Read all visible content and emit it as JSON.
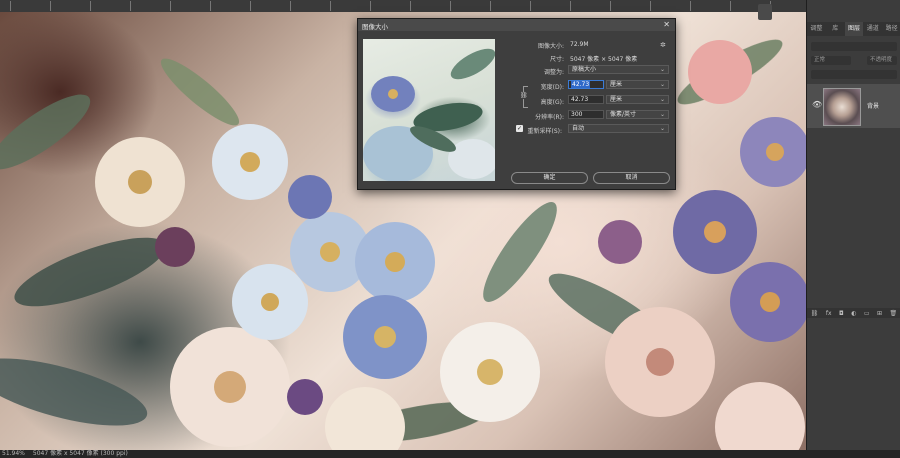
{
  "status_bar": {
    "zoom": "51.94%",
    "doc_info": "5047 像素 x 5047 像素 (300 ppi)"
  },
  "panel": {
    "tabs": [
      "调整",
      "库",
      "图层",
      "通道",
      "路径"
    ],
    "active_tab": "图层",
    "search_placeholder": "正常",
    "opacity_label": "不透明度",
    "layer_name": "背景",
    "bottom_icons": [
      "link-icon",
      "fx-icon",
      "mask-icon",
      "adjustment-icon",
      "group-icon",
      "new-layer-icon",
      "trash-icon"
    ]
  },
  "dialog": {
    "title": "图像大小",
    "close": "✕",
    "image_size_label": "图像大小:",
    "image_size_value": "72.9M",
    "dimensions_label": "尺寸:",
    "dimensions_value": "5047 像素 × 5047 像素",
    "fit_label": "调整为:",
    "fit_value": "原稿大小",
    "width_label": "宽度(D):",
    "width_value": "42.73",
    "width_unit": "厘米",
    "height_label": "高度(G):",
    "height_value": "42.73",
    "height_unit": "厘米",
    "resolution_label": "分辨率(R):",
    "resolution_value": "300",
    "resolution_unit": "像素/英寸",
    "resample_label": "重新采样(S):",
    "resample_value": "自动",
    "resample_checked": true,
    "ok_label": "确定",
    "cancel_label": "取消"
  },
  "colors": {
    "accent": "#3a7bd5",
    "panel_bg": "#3c3c3c",
    "dialog_bg": "#3e3e3e"
  }
}
